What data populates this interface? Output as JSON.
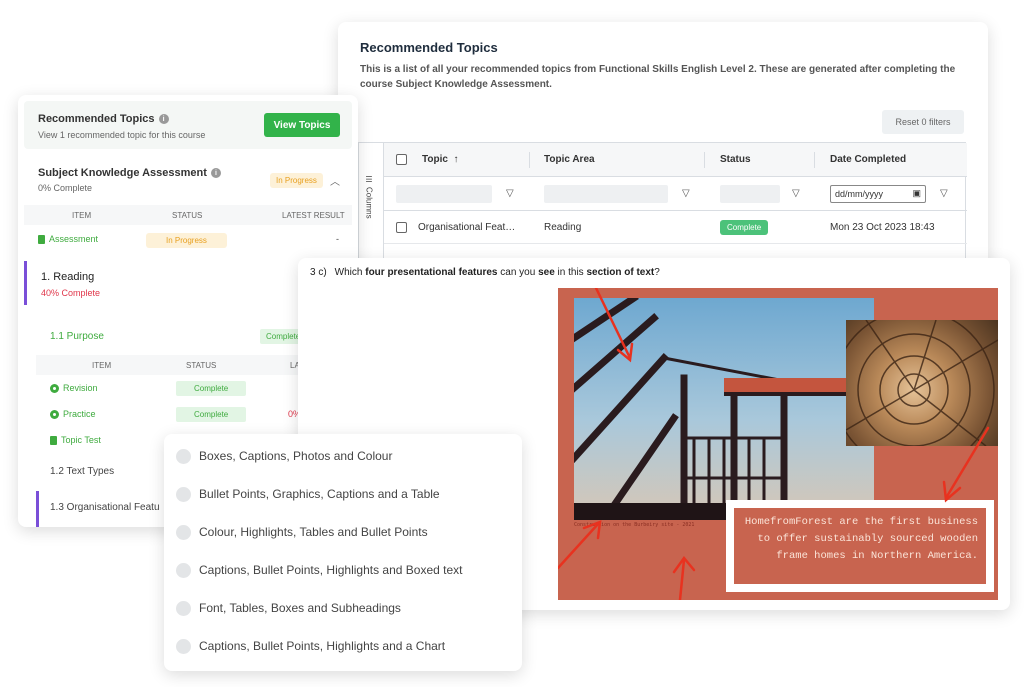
{
  "topics_panel": {
    "title": "Recommended Topics",
    "description": "This is a list of all your recommended topics from Functional Skills English Level 2. These are generated after completing the course Subject Knowledge Assessment.",
    "reset_label": "Reset 0 filters",
    "columns_label": "Columns",
    "headers": {
      "topic": "Topic",
      "topic_area": "Topic Area",
      "status": "Status",
      "date_completed": "Date Completed"
    },
    "sort_indicator": "↑",
    "date_placeholder": "dd/mm/yyyy",
    "rows": [
      {
        "topic": "Organisational Feat…",
        "topic_area": "Reading",
        "status": "Complete",
        "date": "Mon 23 Oct 2023 18:43"
      }
    ]
  },
  "course_panel": {
    "recommended": {
      "title": "Recommended Topics",
      "subtitle": "View 1 recommended topic for this course",
      "button": "View Topics"
    },
    "assessment": {
      "title": "Subject Knowledge Assessment",
      "progress": "0% Complete",
      "badge": "In Progress",
      "headers": {
        "item": "ITEM",
        "status": "STATUS",
        "result": "LATEST RESULT"
      },
      "item": {
        "label": "Assessment",
        "status": "In Progress",
        "result": "-"
      }
    },
    "reading": {
      "title": "1. Reading",
      "progress": "40% Complete"
    },
    "purpose": {
      "title": "1.1 Purpose",
      "badge": "Complete",
      "headers": {
        "item": "ITEM",
        "status": "STATUS",
        "result": "LATEST"
      },
      "items": [
        {
          "label": "Revision",
          "status": "Complete",
          "result": ""
        },
        {
          "label": "Practice",
          "status": "Complete",
          "result": "0%"
        },
        {
          "label": "Topic Test",
          "status": "",
          "result": ""
        }
      ]
    },
    "text_types": "1.2 Text Types",
    "org_features": "1.3 Organisational Featu"
  },
  "question": {
    "number": "3 c)",
    "parts": [
      "Which ",
      "four presentational features",
      " can you ",
      "see",
      " in this ",
      "section of text",
      "?"
    ],
    "photo_caption": "Construction on the Burbeiry site - 2021",
    "boxed_text": "HomefromForest are the first business to offer sustainably sourced wooden frame homes in Northern America.",
    "colors": {
      "stimulus_bg": "#c8644f",
      "arrow": "#e8321f"
    }
  },
  "options": [
    "Boxes, Captions, Photos and Colour",
    "Bullet Points, Graphics, Captions and a Table",
    "Colour, Highlights, Tables and Bullet Points",
    "Captions, Bullet Points, Highlights and Boxed text",
    "Font, Tables, Boxes and Subheadings",
    "Captions, Bullet Points, Highlights and a Chart"
  ],
  "colors": {
    "green": "#32b34a",
    "purple": "#7a4fd8",
    "red": "#e0374b",
    "amber": "#e8a020"
  }
}
